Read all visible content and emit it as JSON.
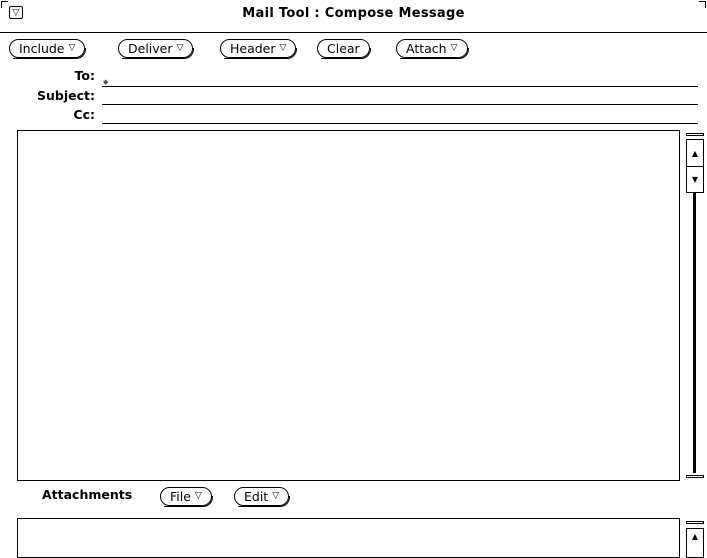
{
  "window": {
    "title": "Mail Tool : Compose Message"
  },
  "toolbar": {
    "buttons": [
      {
        "label": "Include",
        "menu": true
      },
      {
        "label": "Deliver",
        "menu": true
      },
      {
        "label": "Header",
        "menu": true
      },
      {
        "label": "Clear",
        "menu": false
      },
      {
        "label": "Attach",
        "menu": true
      }
    ]
  },
  "fields": {
    "to": {
      "label": "To:",
      "value": ""
    },
    "subject": {
      "label": "Subject:",
      "value": ""
    },
    "cc": {
      "label": "Cc:",
      "value": ""
    }
  },
  "attachments": {
    "label": "Attachments",
    "buttons": [
      {
        "label": "File",
        "menu": true
      },
      {
        "label": "Edit",
        "menu": true
      }
    ]
  },
  "icons": {
    "window_menu": "triangle-down-icon",
    "menu_indicator": "▽",
    "scroll_up": "▲",
    "scroll_down": "▼"
  }
}
